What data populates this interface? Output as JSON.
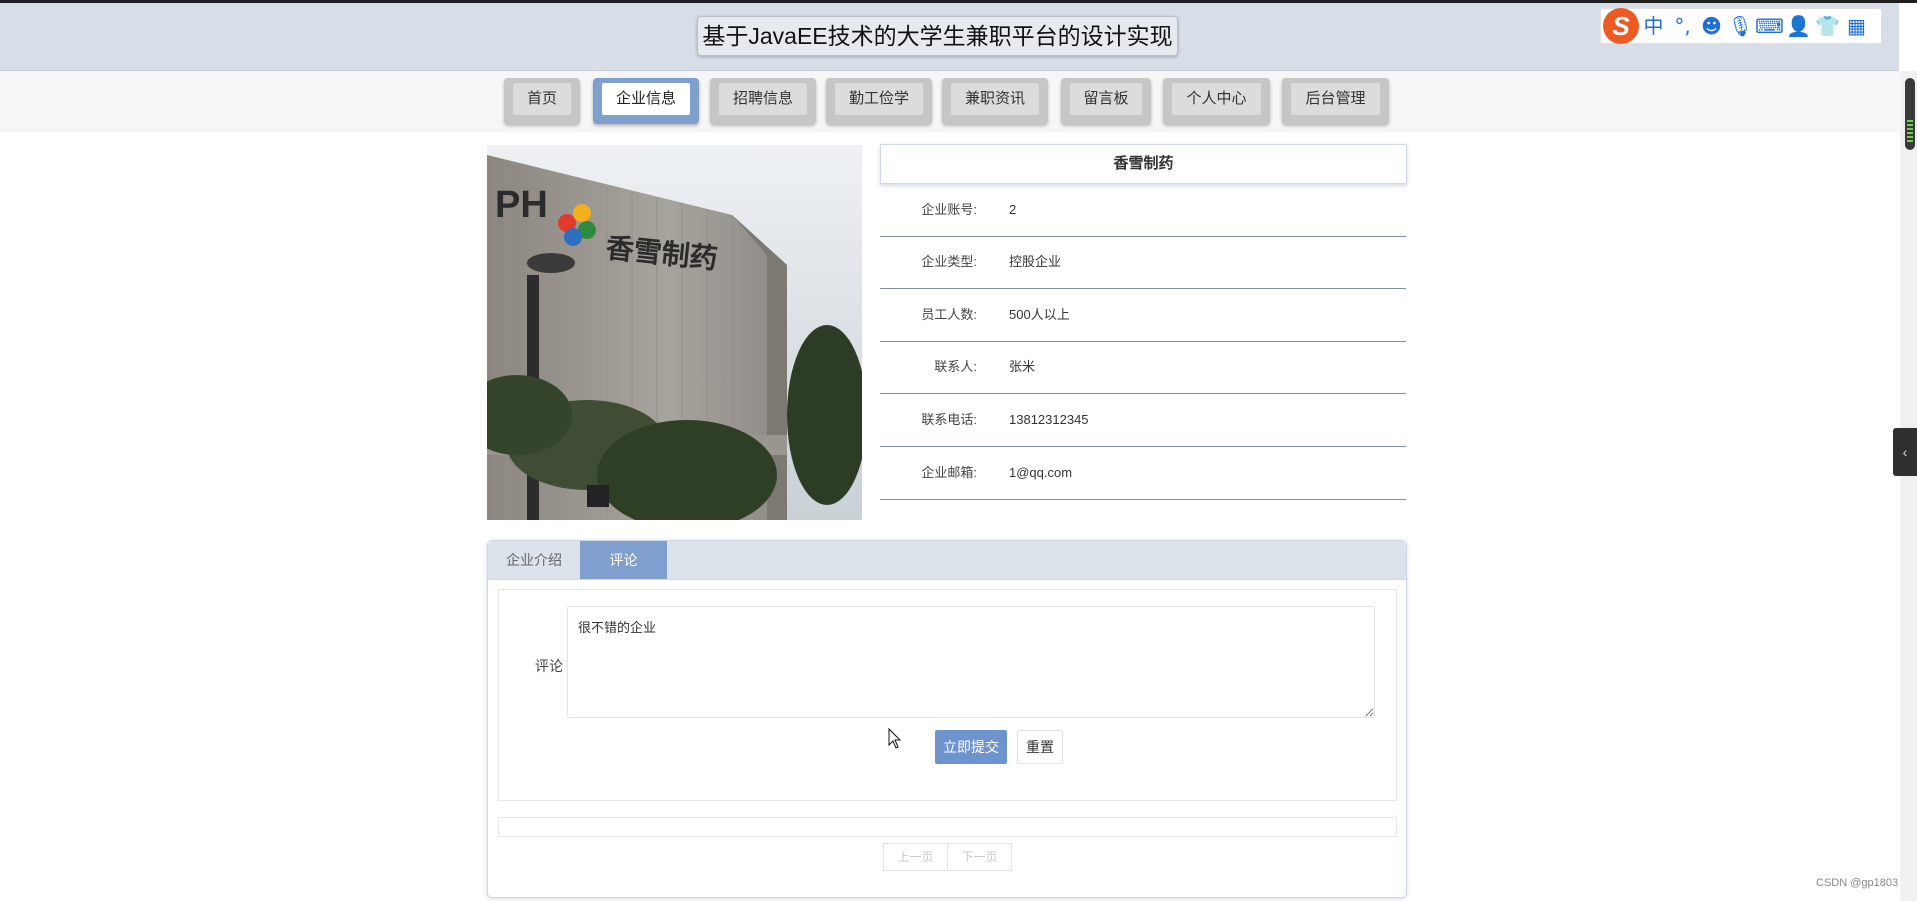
{
  "header": {
    "site_title": "基于JavaEE技术的大学生兼职平台的设计实现"
  },
  "ime_toolbar": {
    "logo": "S",
    "items": [
      {
        "icon": "chinese-mode-icon",
        "glyph": "中"
      },
      {
        "icon": "punctuation-icon",
        "glyph": "°,"
      },
      {
        "icon": "emoji-icon",
        "glyph": "☻"
      },
      {
        "icon": "microphone-icon",
        "glyph": "🎙"
      },
      {
        "icon": "keyboard-icon",
        "glyph": "⌨"
      },
      {
        "icon": "user-icon",
        "glyph": "👤"
      },
      {
        "icon": "skin-icon",
        "glyph": "👕"
      },
      {
        "icon": "apps-grid-icon",
        "glyph": "▦"
      }
    ]
  },
  "nav": {
    "items": [
      {
        "label": "首页",
        "active": false
      },
      {
        "label": "企业信息",
        "active": true
      },
      {
        "label": "招聘信息",
        "active": false
      },
      {
        "label": "勤工俭学",
        "active": false
      },
      {
        "label": "兼职资讯",
        "active": false
      },
      {
        "label": "留言板",
        "active": false
      },
      {
        "label": "个人中心",
        "active": false
      },
      {
        "label": "后台管理",
        "active": false
      }
    ]
  },
  "company": {
    "name": "香雪制药",
    "photo_sign_text": "香雪制药",
    "fields": [
      {
        "label": "企业账号:",
        "value": "2"
      },
      {
        "label": "企业类型:",
        "value": "控股企业"
      },
      {
        "label": "员工人数:",
        "value": "500人以上"
      },
      {
        "label": "联系人:",
        "value": "张米"
      },
      {
        "label": "联系电话:",
        "value": "13812312345"
      },
      {
        "label": "企业邮箱:",
        "value": "1@qq.com"
      }
    ]
  },
  "tabs": {
    "items": [
      {
        "label": "企业介绍",
        "active": false
      },
      {
        "label": "评论",
        "active": true
      }
    ]
  },
  "comment_form": {
    "label": "评论",
    "value": "很不错的企业",
    "submit_label": "立即提交",
    "reset_label": "重置"
  },
  "pager": {
    "prev_label": "上一页",
    "next_label": "下一页"
  },
  "side_toggle": {
    "glyph": "‹"
  },
  "watermark": "CSDN @gp1803",
  "colors": {
    "accent": "#7fa0cf",
    "submit": "#6d94cc",
    "header_bg": "#d7dee8",
    "row_divider": "#7c8fad"
  }
}
